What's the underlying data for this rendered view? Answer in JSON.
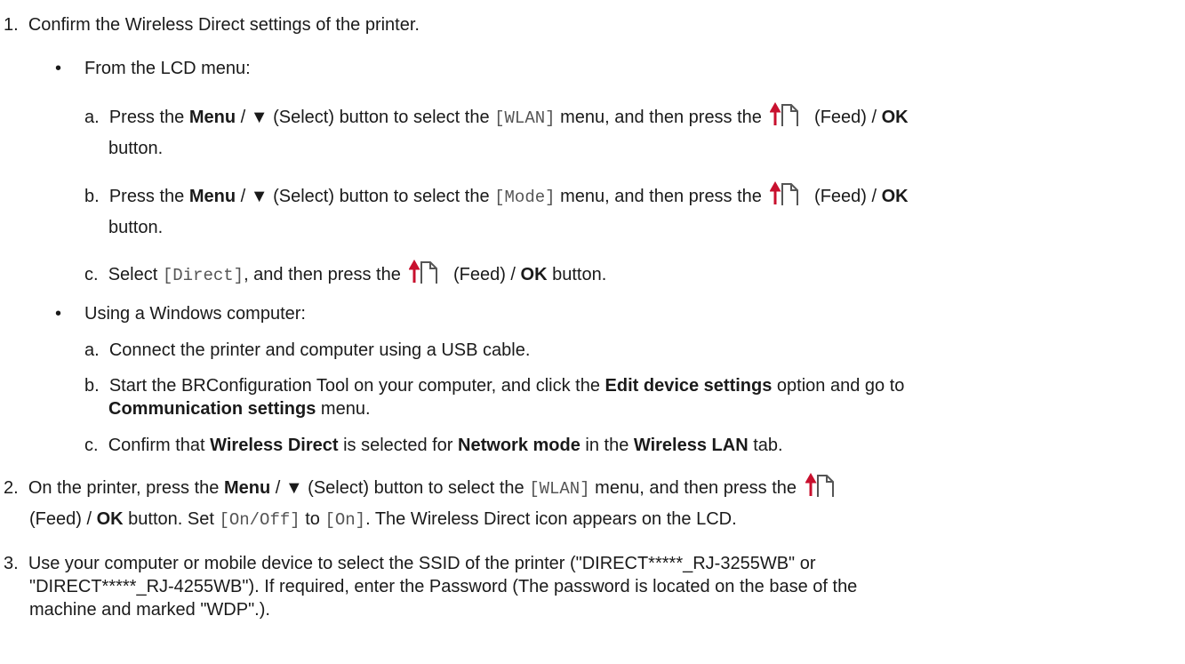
{
  "step1": {
    "num": "1.",
    "text": "Confirm the Wireless Direct settings of the printer.",
    "bullet": "•",
    "lcd": {
      "heading": "From the LCD menu:",
      "a": {
        "letter": "a.",
        "p1": "Press the ",
        "menu": "Menu",
        "p2": " / ▼ (Select) button to select the ",
        "code": "[WLAN]",
        "p3": " menu, and then press the ",
        "feed": " (Feed) / ",
        "ok": "OK",
        "cont": "button."
      },
      "b": {
        "letter": "b.",
        "p1": "Press the ",
        "menu": "Menu",
        "p2": " / ▼ (Select) button to select the ",
        "code": "[Mode]",
        "p3": " menu, and then press the ",
        "feed": " (Feed) / ",
        "ok": "OK",
        "cont": "button."
      },
      "c": {
        "letter": "c.",
        "p1": "Select ",
        "code": "[Direct]",
        "p2": ", and then press the ",
        "feed": " (Feed) / ",
        "ok": "OK",
        "p3": " button."
      }
    },
    "windows": {
      "heading": "Using a Windows computer:",
      "a": {
        "letter": "a.",
        "text": "Connect the printer and computer using a USB cable."
      },
      "b": {
        "letter": "b.",
        "p1": "Start the BRConfiguration Tool on your computer, and click the ",
        "bold1": "Edit device settings",
        "p2": " option and go to",
        "bold2": "Communication settings",
        "p3": " menu."
      },
      "c": {
        "letter": "c.",
        "p1": "Confirm that ",
        "bold1": "Wireless Direct",
        "p2": " is selected for ",
        "bold2": "Network mode",
        "p3": " in the ",
        "bold3": "Wireless LAN",
        "p4": " tab."
      }
    }
  },
  "step2": {
    "num": "2.",
    "p1": "On the printer, press the ",
    "menu": "Menu",
    "p2": " / ▼ (Select) button to select the ",
    "code1": "[WLAN]",
    "p3": " menu, and then press the ",
    "l2a": "(Feed) / ",
    "ok": "OK",
    "l2b": " button. Set ",
    "code2": "[On/Off]",
    "l2c": " to ",
    "code3": "[On]",
    "l2d": ". The Wireless Direct icon appears on the LCD."
  },
  "step3": {
    "num": "3.",
    "line1": "Use your computer or mobile device to select the SSID of the printer (\"DIRECT*****_RJ-3255WB\" or",
    "line2": "\"DIRECT*****_RJ-4255WB\"). If required, enter the Password (The password is located on the base of the",
    "line3": "machine and marked \"WDP\".)."
  },
  "icons": {
    "feed": "feed-arrow-paper-icon"
  }
}
